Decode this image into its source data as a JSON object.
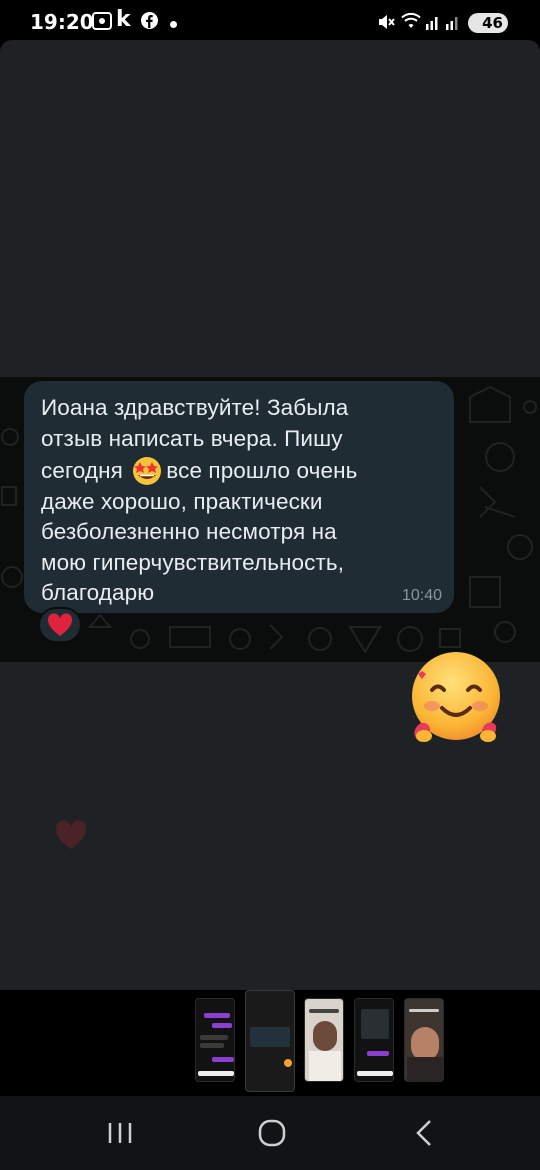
{
  "status_bar": {
    "time": "19:20",
    "battery": "46",
    "icons": [
      "screenshot-icon",
      "k-app-icon",
      "facebook-icon",
      "dot-icon",
      "mute-icon",
      "wifi-icon",
      "signal-icon",
      "signal-icon-2",
      "battery-icon"
    ]
  },
  "message": {
    "line1": "Иоана здравствуйте! Забыла",
    "line2": "отзыв написать вчера. Пишу",
    "line3_before": "сегодня ",
    "line3_after": "все прошло очень",
    "line4": "даже хорошо, практически",
    "line5": "безболезненно несмотря на",
    "line6": "мою гиперчувствительность,",
    "line7": "благодарю",
    "time": "10:40",
    "inline_emoji": "star-struck-emoji",
    "reaction": "red-heart"
  },
  "sticker": "smiling-face-with-hearts-hands-emoji",
  "colors": {
    "bubble": "#1f2c34",
    "card": "#1f2224",
    "chat_bg": "#0b0c0c",
    "timestamp": "#8696a0",
    "heart": "#e0233d"
  },
  "thumbnails": [
    "story-chat-1",
    "story-chat-2",
    "story-photo-1",
    "story-chat-3",
    "story-photo-2"
  ],
  "navigation": [
    "recents-button",
    "home-button",
    "back-button"
  ]
}
